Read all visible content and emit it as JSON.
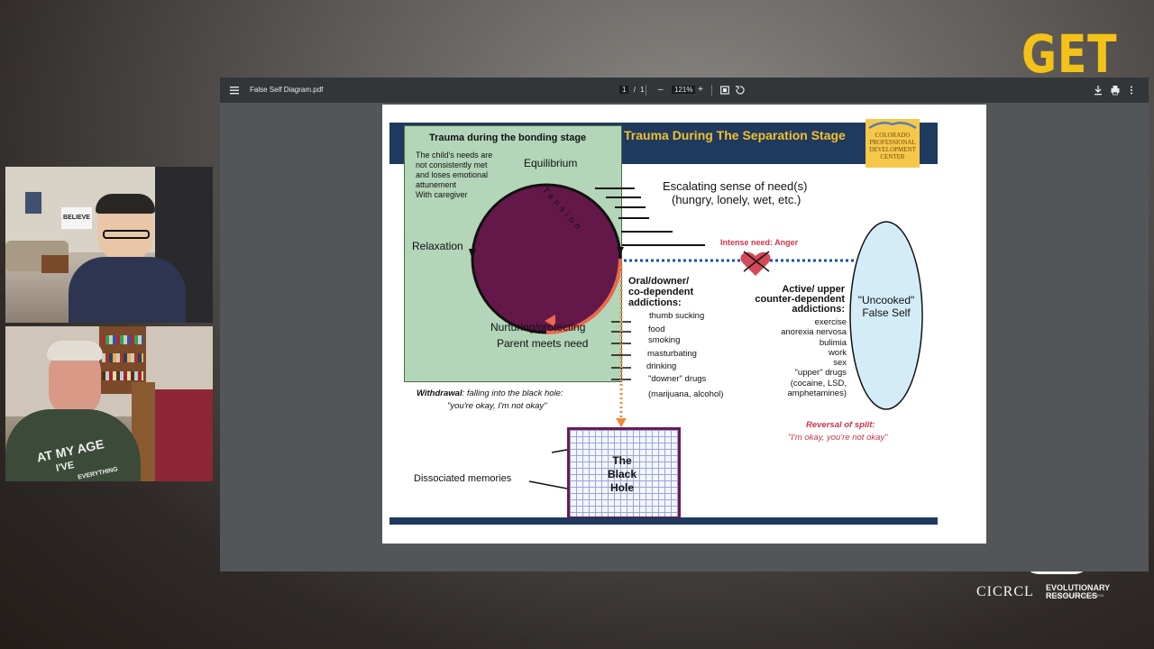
{
  "overlay": {
    "get_text": "GET",
    "brand_name": "CICRCL",
    "brand_tagline": "EVOLUTIONARY RESOURCES",
    "brand_subtagline": "FOR SHIFTING CONSCIOUSNESS"
  },
  "webcam": {
    "poster_text": "BELIEVE",
    "shirt_line1": "AT MY AGE",
    "shirt_line2": "I'VE",
    "shirt_line3": "EVERYTHING"
  },
  "viewer": {
    "filename": "False Self Diagram.pdf",
    "page_current": "1",
    "page_sep": "/",
    "page_total": "1",
    "zoom_minus": "–",
    "zoom": "121%",
    "zoom_plus": "+"
  },
  "slide": {
    "title": "Trauma During The Separation Stage",
    "logo_lines": [
      "COLORADO",
      "PROFESSIONAL",
      "DEVELOPMENT",
      "CENTER"
    ],
    "bonding_title": "Trauma during the bonding stage",
    "needs_lines": [
      "The child's needs are",
      "not consistently met",
      "and loses emotional",
      "attunement",
      "With caregiver"
    ],
    "equilibrium": "Equilibrium",
    "tension": "Tension",
    "relaxation": "Relaxation",
    "nurturing": "Nurturing/protecting",
    "parent_meets": "Parent meets need",
    "escalating_1": "Escalating sense of need(s)",
    "escalating_2": "(hungry, lonely, wet, etc.)",
    "intense_need": "Intense need: Anger",
    "oral_lines": [
      "Oral/downer/",
      "co-dependent",
      "addictions:"
    ],
    "oral_items": [
      "thumb sucking",
      "food",
      "smoking",
      "masturbating",
      "drinking",
      "\"downer\" drugs",
      "(marijuana, alcohol)"
    ],
    "active_lines": [
      "Active/ upper",
      "counter-dependent",
      "addictions:"
    ],
    "active_items": [
      "exercise",
      "anorexia nervosa",
      "bulimia",
      "work",
      "sex",
      "\"upper\" drugs",
      "(cocaine, LSD,",
      "amphetamines)"
    ],
    "false_self_1": "\"Uncooked\"",
    "false_self_2": "False Self",
    "withdrawal_label": "Withdrawal",
    "withdrawal_rest": ": falling into the black hole:",
    "withdrawal_quote": "\"you're okay, I'm not okay\"",
    "reversal_label": "Reversal of split:",
    "reversal_quote": "\"I'm okay, you're not okay\"",
    "dissociated": "Dissociated memories",
    "black_hole_lines": [
      "The",
      "Black",
      "Hole"
    ]
  }
}
